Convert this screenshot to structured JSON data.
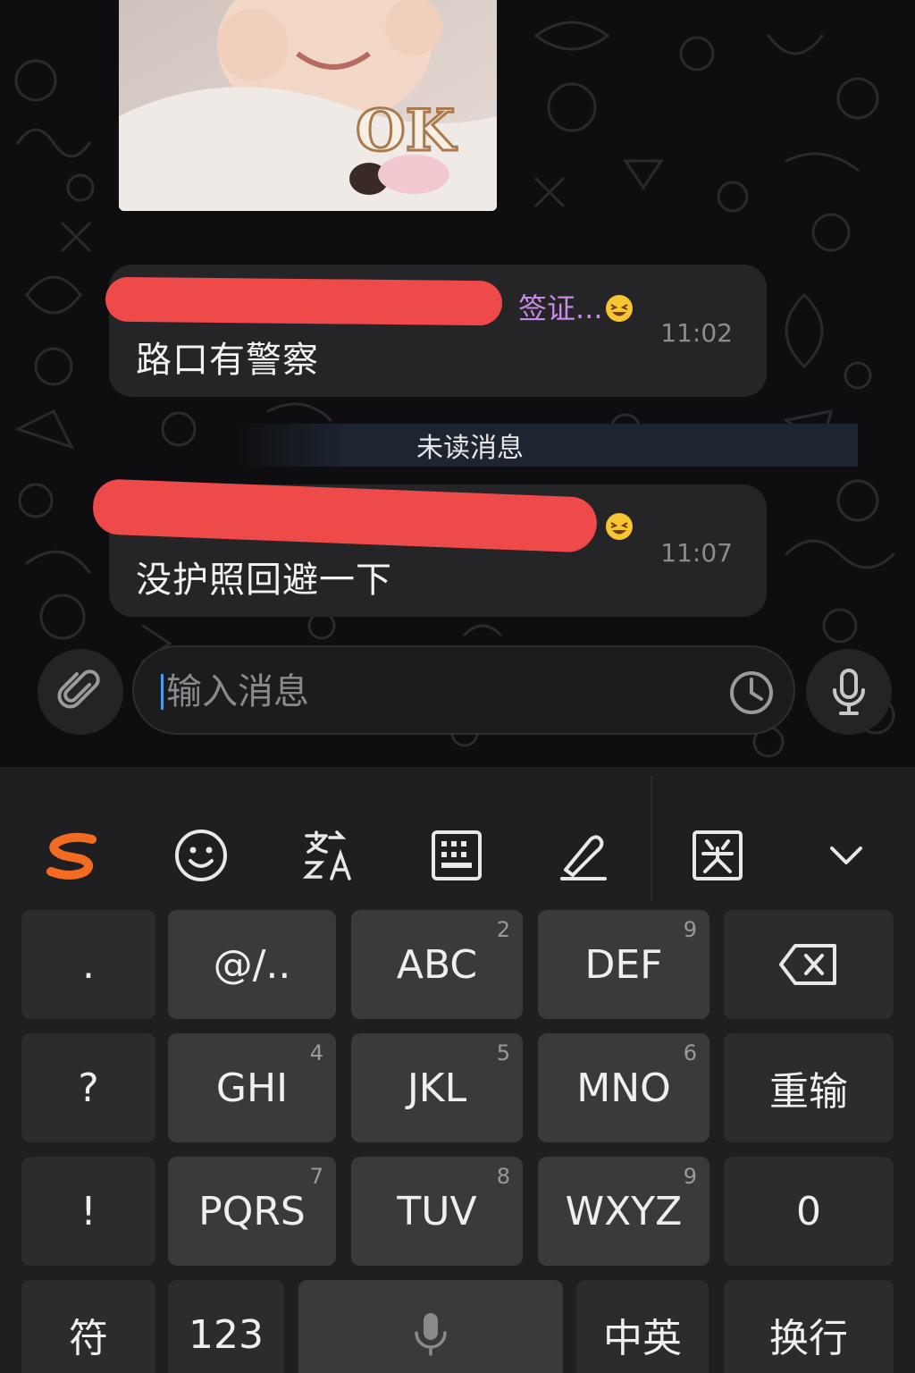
{
  "chat": {
    "messages": [
      {
        "sender": "签证...",
        "text": "路口有警察",
        "time": "11:02"
      },
      {
        "sender": "",
        "text": "没护照回避一下",
        "time": "11:07"
      }
    ],
    "sticker_text": "OK",
    "unread_label": "未读消息",
    "composer": {
      "placeholder": "输入消息"
    }
  },
  "keyboard": {
    "toolbar_icons": [
      "sogou-logo-icon",
      "emoji-icon",
      "translate-icon",
      "grid-keyboard-icon",
      "handwriting-icon",
      "cursor-edit-icon",
      "collapse-keyboard-icon"
    ],
    "rows": [
      [
        {
          "label": "."
        },
        {
          "label": "@/.."
        },
        {
          "label": "ABC",
          "num": "2"
        },
        {
          "label": "DEF",
          "num": "9"
        },
        {
          "label": "⌫"
        }
      ],
      [
        {
          "label": "?"
        },
        {
          "label": "GHI",
          "num": "4"
        },
        {
          "label": "JKL",
          "num": "5"
        },
        {
          "label": "MNO",
          "num": "6"
        },
        {
          "label": "重输"
        }
      ],
      [
        {
          "label": "!"
        },
        {
          "label": "PQRS",
          "num": "7"
        },
        {
          "label": "TUV",
          "num": "8"
        },
        {
          "label": "WXYZ",
          "num": "9"
        },
        {
          "label": "0"
        }
      ],
      [
        {
          "label": "符"
        },
        {
          "label": "123"
        },
        {
          "label": ""
        },
        {
          "label": "中英"
        },
        {
          "label": "换行"
        }
      ]
    ]
  },
  "colors": {
    "bubble": "#252528",
    "redaction": "#ee4a4a",
    "sender": "#c98be0",
    "accent_brand": "#f26b21",
    "caret": "#4d9be6"
  }
}
